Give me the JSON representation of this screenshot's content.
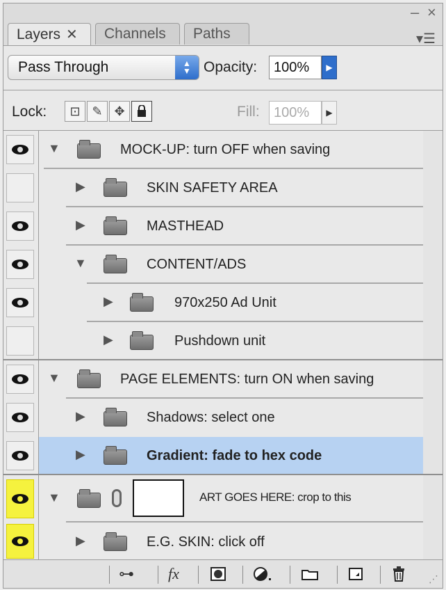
{
  "tabs": [
    {
      "label": "Layers",
      "active": true,
      "close": "✕"
    },
    {
      "label": "Channels",
      "active": false
    },
    {
      "label": "Paths",
      "active": false
    }
  ],
  "window": {
    "minimize": "–",
    "close": "×"
  },
  "controls": {
    "blend_mode": "Pass Through",
    "opacity_label": "Opacity:",
    "opacity_value": "100%",
    "lock_label": "Lock:",
    "fill_label": "Fill:",
    "fill_value": "100%"
  },
  "layers": [
    {
      "name": "MOCK-UP: turn OFF when saving",
      "visible": true,
      "expanded": true,
      "indent": 0
    },
    {
      "name": "SKIN SAFETY AREA",
      "visible": false,
      "expanded": false,
      "indent": 1
    },
    {
      "name": "MASTHEAD",
      "visible": true,
      "expanded": false,
      "indent": 1
    },
    {
      "name": "CONTENT/ADS",
      "visible": true,
      "expanded": true,
      "indent": 1
    },
    {
      "name": "970x250 Ad Unit",
      "visible": true,
      "expanded": false,
      "indent": 2
    },
    {
      "name": "Pushdown unit",
      "visible": false,
      "expanded": false,
      "indent": 2
    },
    {
      "name": "PAGE ELEMENTS: turn ON when saving",
      "visible": true,
      "expanded": true,
      "indent": 0
    },
    {
      "name": "Shadows: select one",
      "visible": true,
      "expanded": false,
      "indent": 1
    },
    {
      "name": "Gradient: fade to hex code",
      "visible": true,
      "expanded": false,
      "indent": 1,
      "selected": true
    },
    {
      "name": "ART GOES HERE: crop to this",
      "visible": true,
      "expanded": true,
      "indent": 0,
      "highlight": true,
      "has_mask": true
    },
    {
      "name": "E.G. SKIN: click off",
      "visible": true,
      "expanded": false,
      "indent": 1,
      "highlight": true
    }
  ],
  "toolbar_icons": [
    "link-icon",
    "fx-icon",
    "mask-icon",
    "adjustment-icon",
    "folder-icon",
    "new-layer-icon",
    "trash-icon"
  ],
  "colors": {
    "selection": "#b7d2f2",
    "highlight": "#f5f23e",
    "accent": "#2e6ecb"
  }
}
